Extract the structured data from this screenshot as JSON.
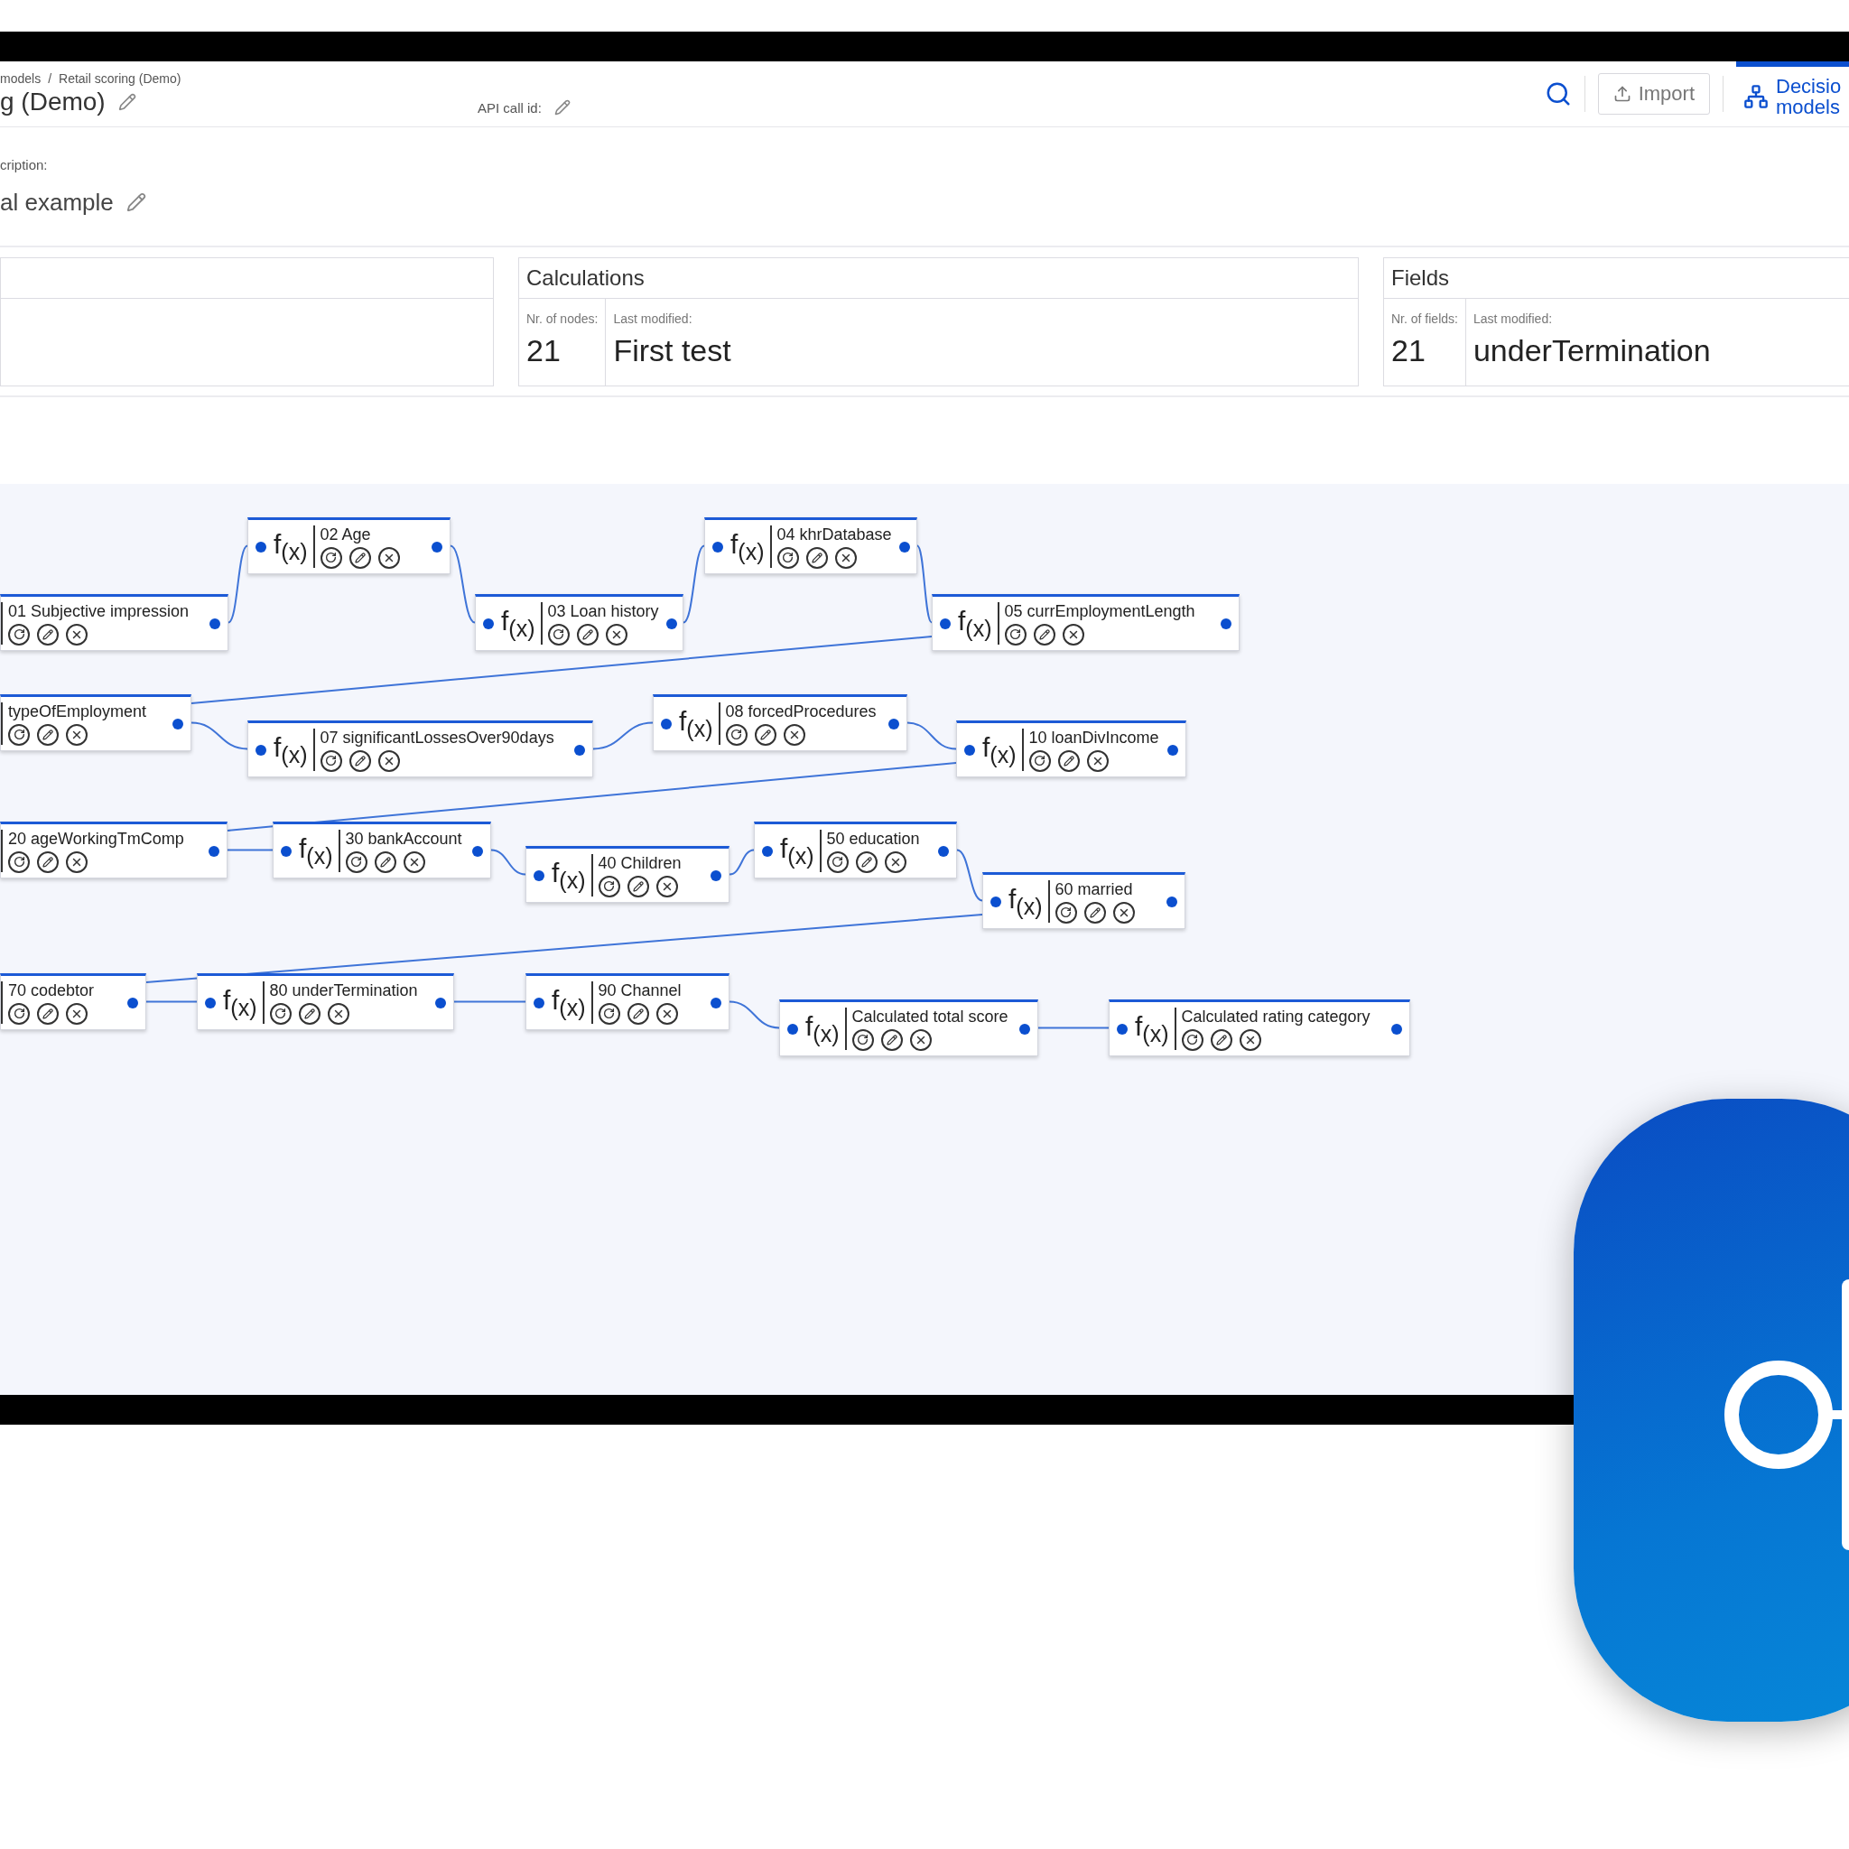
{
  "breadcrumb": {
    "items": [
      "models",
      "Retail scoring (Demo)"
    ],
    "separator": "/"
  },
  "title": "g (Demo)",
  "api_call_label": "API call id:",
  "toolbar": {
    "import_label": "Import",
    "nav_tab": {
      "label": "Decisio models",
      "selected": true
    }
  },
  "description": {
    "label": "cription:",
    "value": "al example"
  },
  "cards": [
    {
      "title": "Calculations",
      "count_label": "Nr. of nodes:",
      "count": "21",
      "modified_label": "Last modified:",
      "modified": "First test"
    },
    {
      "title": "Fields",
      "count_label": "Nr. of fields:",
      "count": "21",
      "modified_label": "Last modified:",
      "modified": "underTermination"
    }
  ],
  "nodes": [
    {
      "kind": "partial",
      "label": "01 Subjective impression"
    },
    {
      "kind": "function",
      "symbol": "f$_{(x)}$",
      "label": "02 Age"
    },
    {
      "kind": "function",
      "symbol": "f$_{(x)}$",
      "label": "03 Loan history"
    },
    {
      "kind": "function",
      "symbol": "f$_{(x)}$",
      "label": "04 khrDatabase"
    },
    {
      "kind": "function",
      "symbol": "f$_{(x)}$",
      "label": "05 currEmploymentLength"
    },
    {
      "kind": "partial",
      "label": "typeOfEmployment"
    },
    {
      "kind": "function",
      "symbol": "f$_{(x)}$",
      "label": "07 significantLossesOver90days"
    },
    {
      "kind": "function",
      "symbol": "f$_{(x)}$",
      "label": "08 forcedProcedures"
    },
    {
      "kind": "function",
      "symbol": "f$_{(x)}$",
      "label": "10 loanDivIncome"
    },
    {
      "kind": "partial",
      "label": "20 ageWorkingTmComp"
    },
    {
      "kind": "function",
      "symbol": "f$_{(x)}$",
      "label": "30 bankAccount"
    },
    {
      "kind": "function",
      "symbol": "f$_{(x)}$",
      "label": "40 Children"
    },
    {
      "kind": "function",
      "symbol": "f$_{(x)}$",
      "label": "50 education"
    },
    {
      "kind": "function",
      "symbol": "f$_{(x)}$",
      "label": "60 married"
    },
    {
      "kind": "partial",
      "label": "70 codebtor"
    },
    {
      "kind": "function",
      "symbol": "f$_{(x)}$",
      "label": "80 underTermination"
    },
    {
      "kind": "function",
      "symbol": "f$_{(x)}$",
      "label": "90 Channel"
    },
    {
      "kind": "function",
      "symbol": "f$_{(x)}$",
      "label": "Calculated total score"
    },
    {
      "kind": "function",
      "symbol": "f$_{(x)}$",
      "label": "Calculated rating category"
    }
  ]
}
